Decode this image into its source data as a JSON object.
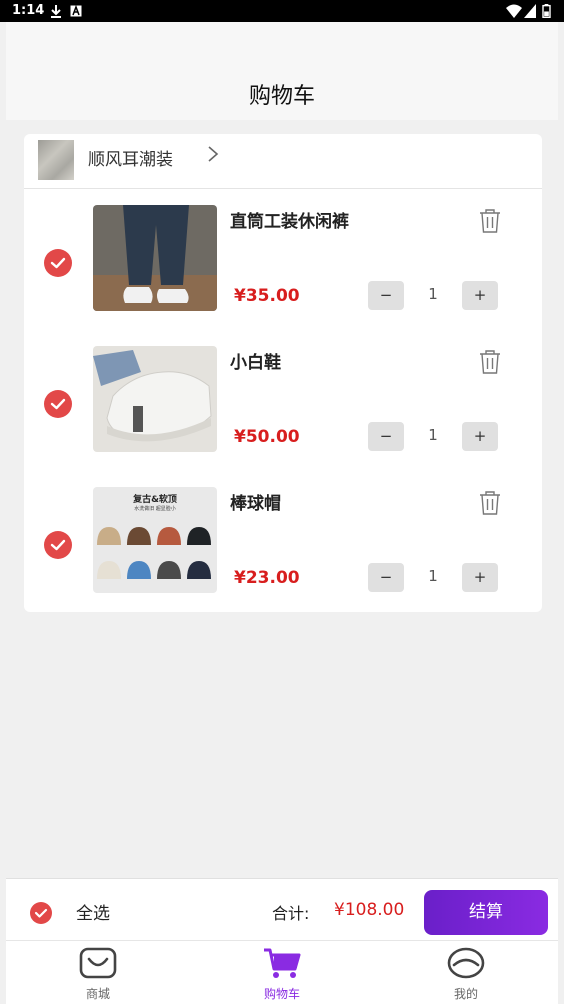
{
  "status_bar": {
    "time": "1:14"
  },
  "header": {
    "title": "购物车"
  },
  "shop": {
    "name": "顺风耳潮装"
  },
  "items": [
    {
      "name": "直筒工装休闲裤",
      "price": "¥35.00",
      "qty": "1"
    },
    {
      "name": "小白鞋",
      "price": "¥50.00",
      "qty": "1"
    },
    {
      "name": "棒球帽",
      "price": "¥23.00",
      "qty": "1"
    }
  ],
  "quantity_controls": {
    "minus": "−",
    "plus": "+"
  },
  "checkout": {
    "select_all": "全选",
    "total_label": "合计:",
    "total_value": "¥108.00",
    "pay_label": "结算"
  },
  "tabs": [
    {
      "label": "商城",
      "icon": "bag-icon"
    },
    {
      "label": "购物车",
      "icon": "cart-icon",
      "active": true
    },
    {
      "label": "我的",
      "icon": "profile-icon"
    }
  ],
  "hat_banner": {
    "title": "复古&软顶",
    "subtitle": "水洗做旧  超显脸小"
  },
  "colors": {
    "accent": "#8a2be2",
    "price": "#d81e1e",
    "check": "#e24848"
  }
}
